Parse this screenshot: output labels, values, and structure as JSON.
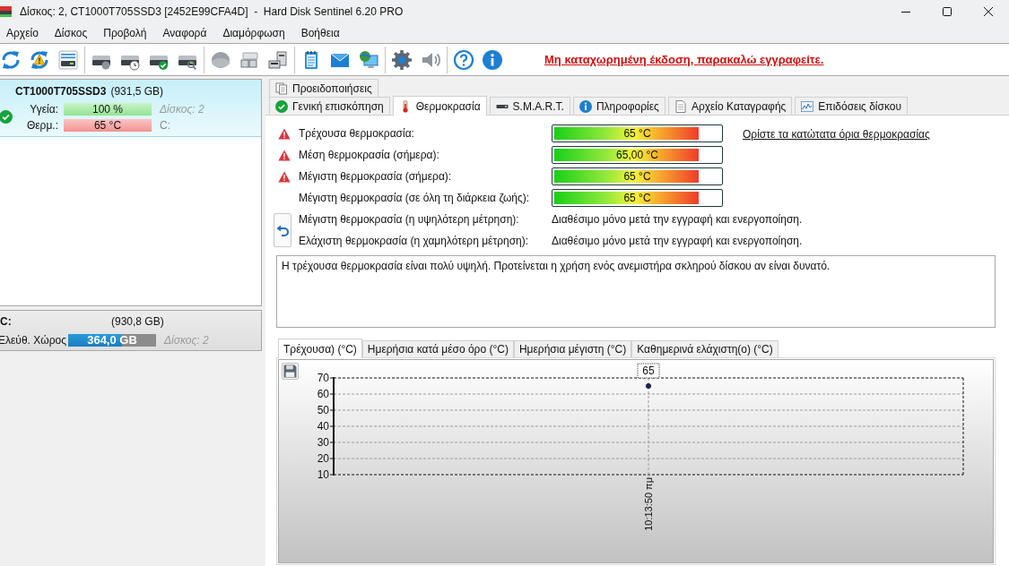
{
  "window": {
    "title": "Δίσκος: 2, CT1000T705SSD3 [2452E99CFA4D]  -  Hard Disk Sentinel 6.20 PRO"
  },
  "menu": [
    "Αρχείο",
    "Δίσκος",
    "Προβολή",
    "Αναφορά",
    "Διαμόρφωση",
    "Βοήθεια"
  ],
  "toolbar": {
    "registration_link": "Μη καταχωρημένη έκδοση, παρακαλώ εγγραφείτε."
  },
  "disks": [
    {
      "model": "CT1000T705SSD3",
      "capacity": "(931,5 GB)",
      "selected": true,
      "health": {
        "label": "Υγεία:",
        "value": "100 %",
        "level": 1
      },
      "temperature": {
        "label": "Θερμ.:",
        "value": "65 °C",
        "level": 1
      },
      "disk_number": "Δίσκος: 2",
      "volume": "C:"
    }
  ],
  "partitions": [
    {
      "drive": "C:",
      "capacity": "(930,8 GB)",
      "free_space": {
        "label": "Ελεύθ. Χώρος",
        "value": "364,0 GB",
        "level": 0.61
      },
      "disk_number": "Δίσκος: 2"
    }
  ],
  "tab_rows": [
    [
      {
        "label": "Προειδοποιήσεις",
        "selected": false
      }
    ],
    [
      {
        "label": "Γενική επισκόπηση",
        "selected": false
      },
      {
        "label": "Θερμοκρασία",
        "selected": true
      },
      {
        "label": "S.M.A.R.T.",
        "selected": false
      },
      {
        "label": "Πληροφορίες",
        "selected": false
      },
      {
        "label": "Αρχείο Καταγραφής",
        "selected": false
      },
      {
        "label": "Επιδόσεις δίσκου",
        "selected": false
      }
    ]
  ],
  "temperature": {
    "readings": [
      {
        "label": "Τρέχουσα θερμοκρασία:",
        "warning": true,
        "value": "65 °C",
        "level": 0.87
      },
      {
        "label": "Μέση θερμοκρασία (σήμερα):",
        "warning": true,
        "value": "65,00 °C",
        "level": 0.87
      },
      {
        "label": "Μέγιστη θερμοκρασία (σήμερα):",
        "warning": true,
        "value": "65 °C",
        "level": 0.87
      },
      {
        "label": "Μέγιστη θερμοκρασία (σε όλη τη διάρκεια ζωής):",
        "warning": false,
        "value": "65 °C",
        "level": 0.87
      }
    ],
    "threshold_link": "Ορίστε τα κατώτατα όρια θερμοκρασίας",
    "records": [
      {
        "label": "Μέγιστη θερμοκρασία (η υψηλότερη μέτρηση):",
        "value": "Διαθέσιμο μόνο μετά την εγγραφή και ενεργοποίηση."
      },
      {
        "label": "Ελάχιστη θερμοκρασία (η χαμηλότερη μέτρηση):",
        "value": "Διαθέσιμο μόνο μετά την εγγραφή και ενεργοποίηση."
      }
    ],
    "message": "Η τρέχουσα θερμοκρασία είναι πολύ υψηλή. Προτείνεται η χρήση ενός ανεμιστήρα σκληρού δίσκου αν είναι δυνατό.",
    "chart_tabs": [
      {
        "label": "Τρέχουσα) (°C)",
        "selected": true
      },
      {
        "label": "Ημερήσια κατά μέσο όρο (°C)",
        "selected": false
      },
      {
        "label": "Ημερήσια μέγιστη (°C)",
        "selected": false
      },
      {
        "label": "Καθημερινά ελάχιστη(ο) (°C)",
        "selected": false
      }
    ],
    "chart_data": {
      "type": "line",
      "x": [
        "10:13:50 πμ"
      ],
      "series": [
        {
          "color": "#1a2550",
          "marker": "circle",
          "values": [
            65
          ]
        }
      ],
      "ylim": [
        10,
        70
      ],
      "yticks": [
        10,
        20,
        30,
        40,
        50,
        60,
        70
      ],
      "grid": true,
      "data_labels": true
    }
  }
}
